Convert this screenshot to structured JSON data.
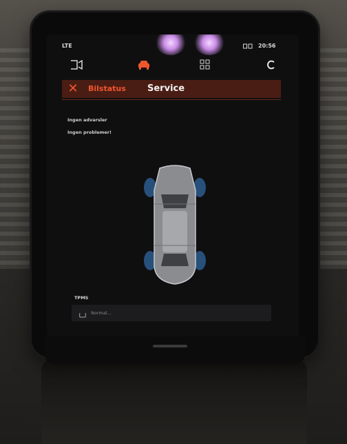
{
  "status_bar": {
    "carrier": "LTE",
    "clock": "20:56"
  },
  "app_bar": {
    "icons": [
      "camera-icon",
      "car-status-icon",
      "apps-grid-icon",
      "climate-icon"
    ],
    "accent": "#f0562c"
  },
  "header": {
    "close_icon": "close-icon",
    "tab_status": "Bilstatus",
    "tab_service": "Service"
  },
  "messages": {
    "line1": "Ingen advarsler",
    "line2": "Ingen problemer!"
  },
  "tpms": {
    "label": "TPMS",
    "value": "Normal..."
  }
}
